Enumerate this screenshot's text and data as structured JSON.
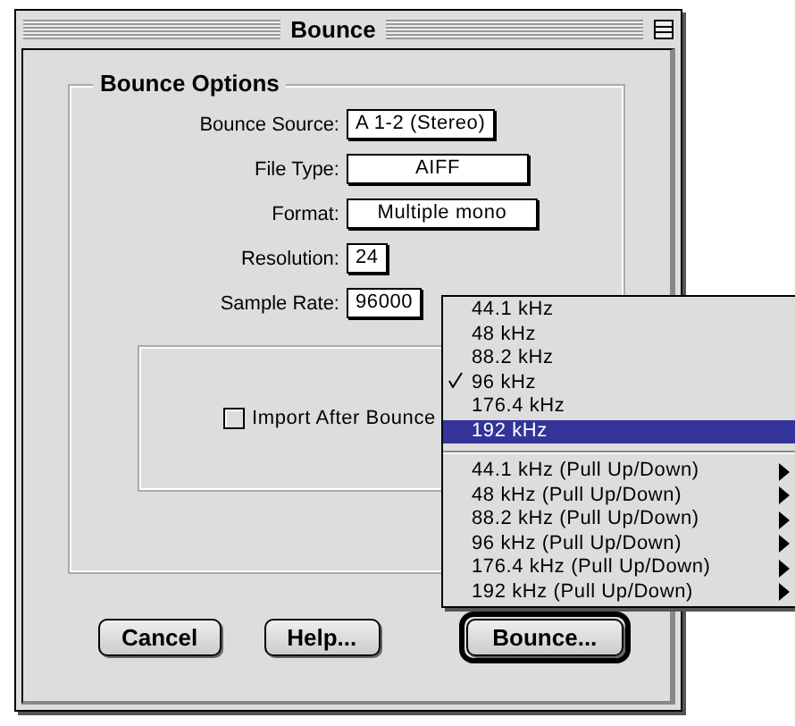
{
  "window": {
    "title": "Bounce"
  },
  "group": {
    "title": "Bounce Options"
  },
  "fields": [
    {
      "label": "Bounce Source:",
      "value": "A 1-2 (Stereo)"
    },
    {
      "label": "File Type:",
      "value": "AIFF"
    },
    {
      "label": "Format:",
      "value": "Multiple mono"
    },
    {
      "label": "Resolution:",
      "value": "24"
    },
    {
      "label": "Sample Rate:",
      "value": "96000"
    }
  ],
  "import_after_bounce": {
    "label": "Import After Bounce",
    "checked": false
  },
  "menu": {
    "groups": [
      [
        {
          "label": "44.1 kHz",
          "checked": false,
          "selected": false,
          "submenu": false
        },
        {
          "label": "48 kHz",
          "checked": false,
          "selected": false,
          "submenu": false
        },
        {
          "label": "88.2 kHz",
          "checked": false,
          "selected": false,
          "submenu": false
        },
        {
          "label": "96 kHz",
          "checked": true,
          "selected": false,
          "submenu": false
        },
        {
          "label": "176.4 kHz",
          "checked": false,
          "selected": false,
          "submenu": false
        },
        {
          "label": "192 kHz",
          "checked": false,
          "selected": true,
          "submenu": false
        }
      ],
      [
        {
          "label": "44.1 kHz (Pull Up/Down)",
          "checked": false,
          "selected": false,
          "submenu": true
        },
        {
          "label": "48 kHz (Pull Up/Down)",
          "checked": false,
          "selected": false,
          "submenu": true
        },
        {
          "label": "88.2 kHz (Pull Up/Down)",
          "checked": false,
          "selected": false,
          "submenu": true
        },
        {
          "label": "96 kHz (Pull Up/Down)",
          "checked": false,
          "selected": false,
          "submenu": true
        },
        {
          "label": "176.4 kHz (Pull Up/Down)",
          "checked": false,
          "selected": false,
          "submenu": true
        },
        {
          "label": "192 kHz (Pull Up/Down)",
          "checked": false,
          "selected": false,
          "submenu": true
        }
      ]
    ]
  },
  "buttons": [
    {
      "label": "Cancel",
      "default": false
    },
    {
      "label": "Help...",
      "default": false
    },
    {
      "label": "Bounce...",
      "default": true
    }
  ]
}
